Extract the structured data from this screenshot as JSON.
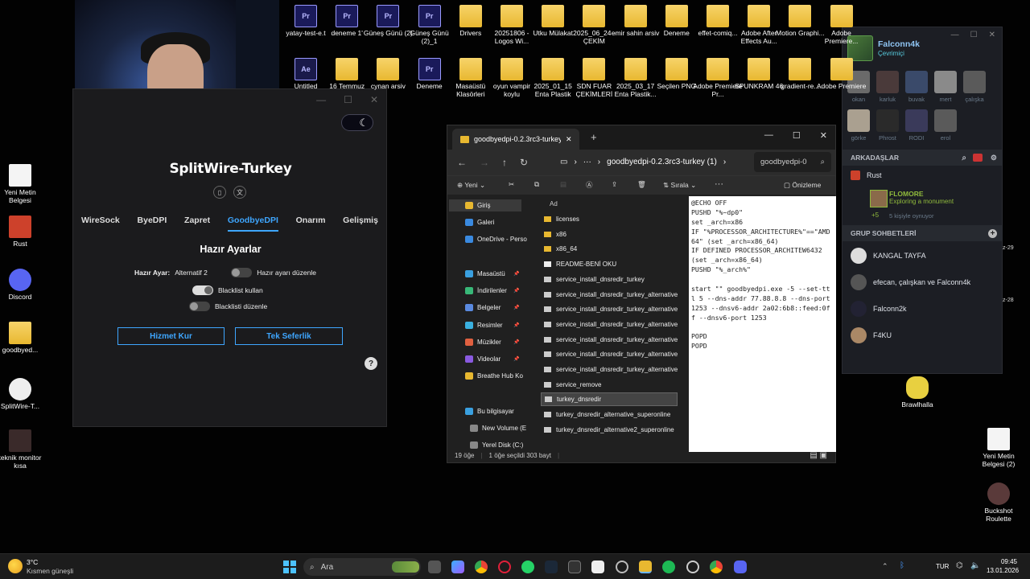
{
  "desktop": {
    "top_icons": [
      {
        "label": "yatay-test-e.t",
        "kind": "pr",
        "badge": "Pr\nPROJ"
      },
      {
        "label": "deneme 1'",
        "kind": "pr",
        "badge": "Pr\nPROJ"
      },
      {
        "label": "Güneş Günü (2)",
        "kind": "pr",
        "badge": "Pr\nPROJ"
      },
      {
        "label": "Güneş Günü (2)_1",
        "kind": "pr",
        "badge": "Pr\nPROJ"
      },
      {
        "label": "Drivers",
        "kind": "folder"
      },
      {
        "label": "20251806 -Logos Wi...",
        "kind": "folder"
      },
      {
        "label": "Utku Mülakat",
        "kind": "folder"
      },
      {
        "label": "2025_06_24 - ÇEKİM",
        "kind": "folder"
      },
      {
        "label": "emir sahin arsiv",
        "kind": "folder"
      },
      {
        "label": "Deneme",
        "kind": "folder"
      },
      {
        "label": "effet-comiq...",
        "kind": "folder"
      },
      {
        "label": "Adobe After Effects Au...",
        "kind": "folder"
      },
      {
        "label": "Motion Graphi...",
        "kind": "folder"
      },
      {
        "label": "Adobe Premiere...",
        "kind": "folder"
      }
    ],
    "row2_icons": [
      {
        "label": "Untitled",
        "kind": "ae",
        "badge": "Ae\nAEP"
      },
      {
        "label": "16 Temmuz",
        "kind": "folder"
      },
      {
        "label": "cynan arsiv",
        "kind": "folder"
      },
      {
        "label": "Deneme",
        "kind": "pr",
        "badge": "Pr\nPROJ"
      },
      {
        "label": "Masaüstü Klasörleri",
        "kind": "folder"
      },
      {
        "label": "oyun vampir koylu",
        "kind": "folder"
      },
      {
        "label": "2025_01_15 Enta Plastik",
        "kind": "folder"
      },
      {
        "label": "SDN FUAR ÇEKİMLERİ",
        "kind": "folder"
      },
      {
        "label": "2025_03_17 Enta Plastik...",
        "kind": "folder"
      },
      {
        "label": "Seçilen PNG",
        "kind": "folder"
      },
      {
        "label": "Adobe Premiere Pr...",
        "kind": "folder"
      },
      {
        "label": "SPUNKRAM 46",
        "kind": "folder"
      },
      {
        "label": "gradient-re...",
        "kind": "folder"
      },
      {
        "label": "Adobe Premiere",
        "kind": "folder"
      }
    ],
    "left_icons": [
      {
        "label": "Yeni Metin Belgesi",
        "kind": "doc"
      },
      {
        "label": "Rust",
        "kind": "rust"
      },
      {
        "label": "Discord",
        "kind": "discord"
      },
      {
        "label": "goodbyed...",
        "kind": "folder"
      },
      {
        "label": "SplitWire-T...",
        "kind": "sw"
      },
      {
        "label": "teknik monitor kısa",
        "kind": "video"
      }
    ],
    "right_icons": [
      {
        "label": "Brawlhalla",
        "kind": "game"
      },
      {
        "label": "Yeni Metin Belgesi (2)",
        "kind": "doc"
      },
      {
        "label": "Buckshot Roulette",
        "kind": "game2"
      }
    ],
    "side_fragments": [
      "z-29",
      "z-28"
    ]
  },
  "splitwire": {
    "title": "SplitWire-Turkey",
    "titlebar": [
      "—",
      "☐",
      "✕"
    ],
    "tabs": [
      "WireSock",
      "ByeDPI",
      "Zapret",
      "GoodbyeDPI",
      "Onarım",
      "Gelişmiş"
    ],
    "active_tab": "GoodbyeDPI",
    "section": "Hazır Ayarlar",
    "preset_label": "Hazır Ayar:",
    "preset_value": "Alternatif 2",
    "edit_preset": "Hazır ayarı düzenle",
    "blacklist_use": "Blacklist kullan",
    "blacklist_edit": "Blacklisti düzenle",
    "btn_service": "Hizmet Kur",
    "btn_once": "Tek Seferlik",
    "help": "?"
  },
  "explorer": {
    "tab_title": "goodbyedpi-0.2.3rc3-turkey (1",
    "address": "goodbyedpi-0.2.3rc3-turkey (1)",
    "search": "goodbyedpi-0",
    "cmd": {
      "new": "Yeni",
      "sort": "Sırala",
      "more": "···",
      "preview": "Önizleme"
    },
    "col_header": "Ad",
    "nav": [
      {
        "label": "Giriş",
        "color": "#e8b830",
        "sel": true
      },
      {
        "label": "Galeri",
        "color": "#3a8ae0"
      },
      {
        "label": "OneDrive - Perso",
        "color": "#3a8ae0"
      },
      {
        "label": "Masaüstü",
        "color": "#3aa0e0",
        "pin": true
      },
      {
        "label": "İndirilenler",
        "color": "#38b878",
        "pin": true
      },
      {
        "label": "Belgeler",
        "color": "#5a8ae0",
        "pin": true
      },
      {
        "label": "Resimler",
        "color": "#3ab0e0",
        "pin": true
      },
      {
        "label": "Müzikler",
        "color": "#e06040",
        "pin": true
      },
      {
        "label": "Videolar",
        "color": "#8a5ae0",
        "pin": true
      },
      {
        "label": "Breathe Hub Ko",
        "color": "#e8b830"
      },
      {
        "label": "Bu bilgisayar",
        "color": "#3aa0e0"
      },
      {
        "label": "New Volume (E",
        "color": "#888"
      },
      {
        "label": "Yerel Disk (C:)",
        "color": "#888"
      }
    ],
    "files": [
      {
        "name": "licenses",
        "type": "folder"
      },
      {
        "name": "x86",
        "type": "folder"
      },
      {
        "name": "x86_64",
        "type": "folder"
      },
      {
        "name": "README-BENİ OKU",
        "type": "text"
      },
      {
        "name": "service_install_dnsredir_turkey",
        "type": "cmd"
      },
      {
        "name": "service_install_dnsredir_turkey_alternative",
        "type": "cmd"
      },
      {
        "name": "service_install_dnsredir_turkey_alternative2",
        "type": "cmd"
      },
      {
        "name": "service_install_dnsredir_turkey_alternative3",
        "type": "cmd"
      },
      {
        "name": "service_install_dnsredir_turkey_alternative4",
        "type": "cmd"
      },
      {
        "name": "service_install_dnsredir_turkey_alternative5",
        "type": "cmd"
      },
      {
        "name": "service_install_dnsredir_turkey_alternative6",
        "type": "cmd"
      },
      {
        "name": "service_remove",
        "type": "cmd"
      },
      {
        "name": "turkey_dnsredir",
        "type": "cmd",
        "selected": true
      },
      {
        "name": "turkey_dnsredir_alternative_superonline",
        "type": "cmd"
      },
      {
        "name": "turkey_dnsredir_alternative2_superonline",
        "type": "cmd"
      }
    ],
    "preview_text": "@ECHO OFF\nPUSHD \"%~dp0\"\nset _arch=x86\nIF \"%PROCESSOR_ARCHITECTURE%\"==\"AMD64\" (set _arch=x86_64)\nIF DEFINED PROCESSOR_ARCHITEW6432 (set _arch=x86_64)\nPUSHD \"%_arch%\"\n\nstart \"\" goodbyedpi.exe -5 --set-ttl 5 --dns-addr 77.88.8.8 --dns-port 1253 --dnsv6-addr 2a02:6b8::feed:0ff --dnsv6-port 1253\n\nPOPD\nPOPD",
    "status_count": "19 öğe",
    "status_sel": "1 öğe seçildi  303 bayt"
  },
  "steam": {
    "user": "Falconn4k",
    "status": "Çevrimiçi",
    "recent": [
      "okan",
      "karluk",
      "buvak",
      "mert",
      "çalışka",
      "görke",
      "Phrost",
      "RODI",
      "erol"
    ],
    "friends_header": "ARKADAŞLAR",
    "game_group": "Rust",
    "friend_name": "FLOMORE",
    "friend_game": "Exploring a monument",
    "plus": "+5",
    "playing": "5 kişiyle oynuyor",
    "groups_header": "GRUP SOHBETLERİ",
    "groups": [
      "KANGAL TAYFA",
      "efecan, çalışkan ve Falconn4k",
      "Falconn2k",
      "F4KU"
    ]
  },
  "taskbar": {
    "weather_temp": "3°C",
    "weather_desc": "Kısmen güneşli",
    "search": "Ara",
    "lang": "TUR",
    "time": "09:45",
    "date": "13.01.2026"
  }
}
